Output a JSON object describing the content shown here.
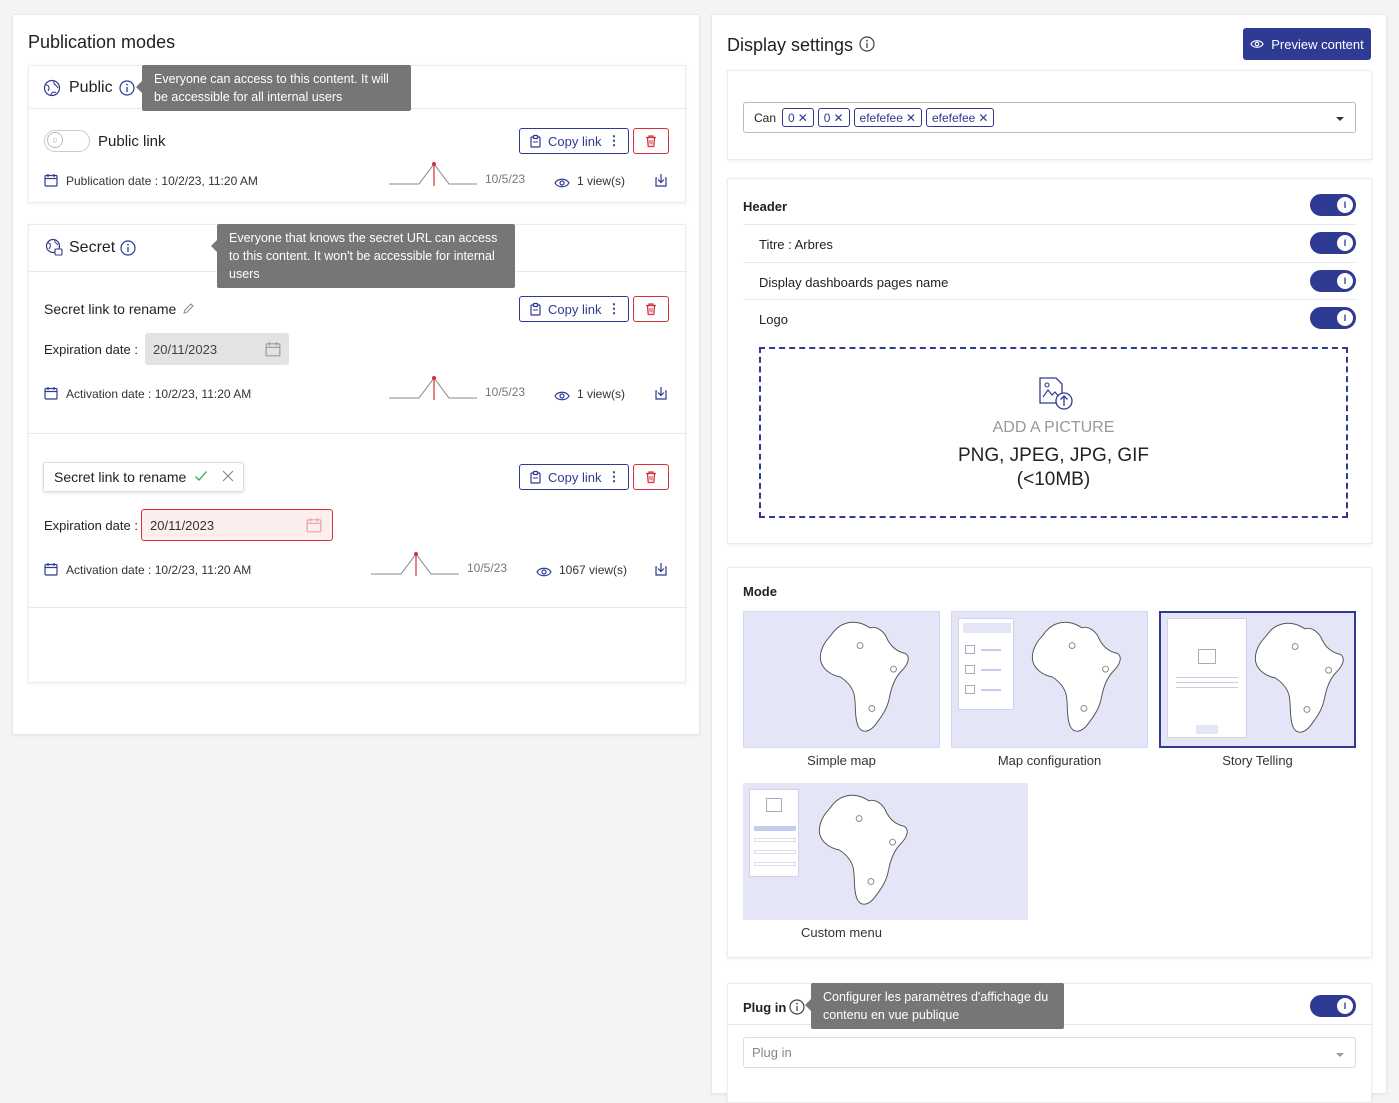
{
  "left": {
    "title": "Publication modes",
    "public": {
      "title": "Public",
      "tooltip": "Everyone can access to this content. It will be accessible for all internal users",
      "link_label": "Public link",
      "copy_label": "Copy link",
      "date_text": "Publication date : 10/2/23, 11:20 AM",
      "spark_date": "10/5/23",
      "views": "1 view(s)"
    },
    "secret": {
      "title": "Secret",
      "tooltip": "Everyone that knows the secret URL can access to this content. It won't be accessible for internal users",
      "links": [
        {
          "name": "Secret link to rename",
          "copy_label": "Copy link",
          "expiration_label": "Expiration date :",
          "expiration_value": "20/11/2023",
          "activation_text": "Activation date : 10/2/23, 11:20 AM",
          "spark_date": "10/5/23",
          "views": "1 view(s)"
        },
        {
          "name": "Secret link to rename",
          "copy_label": "Copy link",
          "expiration_label": "Expiration date :",
          "expiration_value": "20/11/2023",
          "activation_text": "Activation date : 10/2/23, 11:20 AM",
          "spark_date": "10/5/23",
          "views": "1067 view(s)"
        }
      ]
    }
  },
  "right": {
    "title": "Display settings",
    "preview_label": "Preview content",
    "tags_select": {
      "prefix": "Can",
      "chips": [
        "0",
        "0",
        "efefefee",
        "efefefee"
      ]
    },
    "header": {
      "title": "Header",
      "rows": [
        "Titre : Arbres",
        "Display dashboards pages name",
        "Logo"
      ],
      "upload_title": "ADD A PICTURE",
      "upload_formats": "PNG, JPEG, JPG, GIF",
      "upload_size": "(<10MB)"
    },
    "mode": {
      "title": "Mode",
      "options": [
        "Simple map",
        "Map configuration",
        "Story Telling",
        "Custom menu"
      ],
      "selected": "Story Telling"
    },
    "plugin": {
      "title": "Plug in",
      "tooltip": "Configurer les paramètres d'affichage du contenu en vue publique",
      "select_placeholder": "Plug in"
    }
  },
  "colors": {
    "accent": "#2f3a92",
    "danger": "#d6303a",
    "tooltip": "#767676",
    "mode_bg": "#e4e6f8"
  }
}
